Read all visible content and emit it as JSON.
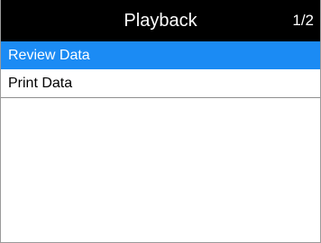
{
  "header": {
    "title": "Playback",
    "page_indicator": "1/2"
  },
  "menu": {
    "items": [
      {
        "label": "Review Data",
        "selected": true
      },
      {
        "label": "Print Data",
        "selected": false
      }
    ]
  },
  "colors": {
    "header_bg": "#000000",
    "header_text": "#ffffff",
    "selected_bg": "#1b8bf4",
    "selected_text": "#ffffff",
    "divider": "#8f8f8f"
  }
}
